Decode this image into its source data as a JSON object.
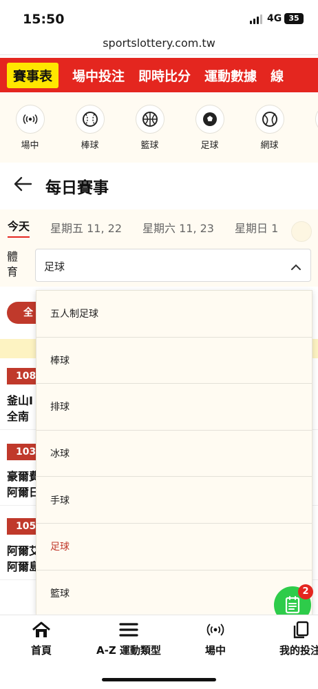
{
  "status_bar": {
    "time": "15:50",
    "network": "4G",
    "battery": "35"
  },
  "browser": {
    "url": "sportslottery.com.tw"
  },
  "top_nav": {
    "items": [
      {
        "label": "賽事表",
        "active": true
      },
      {
        "label": "場中投注",
        "active": false
      },
      {
        "label": "即時比分",
        "active": false
      },
      {
        "label": "運動數據",
        "active": false
      },
      {
        "label": "線",
        "active": false
      }
    ]
  },
  "sports": [
    {
      "label": "場中",
      "icon": "live-signal-icon"
    },
    {
      "label": "棒球",
      "icon": "baseball-icon"
    },
    {
      "label": "籃球",
      "icon": "basketball-icon"
    },
    {
      "label": "足球",
      "icon": "soccer-icon"
    },
    {
      "label": "網球",
      "icon": "tennis-icon"
    }
  ],
  "page": {
    "title": "每日賽事"
  },
  "date_tabs": [
    {
      "label": "今天",
      "active": true
    },
    {
      "label": "星期五 11, 22",
      "active": false
    },
    {
      "label": "星期六 11, 23",
      "active": false
    },
    {
      "label": "星期日 1",
      "active": false
    }
  ],
  "sport_filter": {
    "label": "體育",
    "selected": "足球"
  },
  "filter_pill": {
    "label": "全"
  },
  "matches": [
    {
      "code": "108",
      "home": "釜山I",
      "away": "全南"
    },
    {
      "code": "103",
      "home": "豪爾費",
      "away": "阿爾日"
    },
    {
      "code": "105",
      "home": "阿爾艾",
      "away": "阿爾島"
    }
  ],
  "dropdown": {
    "options": [
      {
        "label": "五人制足球",
        "selected": false
      },
      {
        "label": "棒球",
        "selected": false
      },
      {
        "label": "排球",
        "selected": false
      },
      {
        "label": "冰球",
        "selected": false
      },
      {
        "label": "手球",
        "selected": false
      },
      {
        "label": "足球",
        "selected": true
      },
      {
        "label": "籃球",
        "selected": false
      }
    ]
  },
  "betslip_badge": {
    "count": "2"
  },
  "bottom_nav": [
    {
      "label": "首頁",
      "icon": "home-icon"
    },
    {
      "label": "A-Z 運動類型",
      "icon": "menu-icon"
    },
    {
      "label": "場中",
      "icon": "live-signal-icon"
    },
    {
      "label": "我的投注",
      "icon": "copy-icon"
    }
  ],
  "colors": {
    "brand_red": "#e4261f",
    "highlight_yellow": "#ffe600",
    "cream": "#fffbf2",
    "fab_green": "#2ecc4a"
  }
}
